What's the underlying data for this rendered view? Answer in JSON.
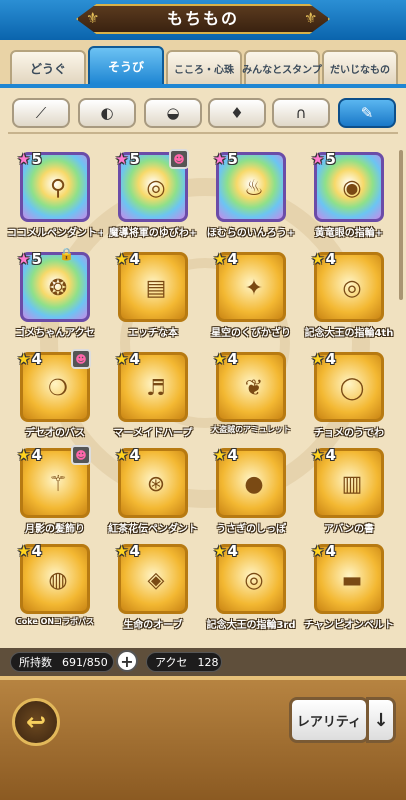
{
  "header": {
    "title": "もちもの"
  },
  "tabs": [
    {
      "label": "どうぐ"
    },
    {
      "label": "そうび"
    },
    {
      "label": "こころ・心珠"
    },
    {
      "label": "みんなとスタンプ"
    },
    {
      "label": "だいじなもの"
    }
  ],
  "categories": [
    {
      "icon": "sword-icon",
      "glyph": "⟋"
    },
    {
      "icon": "shield-icon",
      "glyph": "◐"
    },
    {
      "icon": "helmet-icon",
      "glyph": "◒"
    },
    {
      "icon": "shirt-icon",
      "glyph": "♦"
    },
    {
      "icon": "pants-icon",
      "glyph": "∩"
    },
    {
      "icon": "accessory-icon",
      "glyph": "✎"
    }
  ],
  "items": [
    {
      "name": "ココメルペンダント+",
      "rank": "5",
      "rainbow": true,
      "icon": "pendant-icon",
      "glyph": "⚲"
    },
    {
      "name": "魔導将軍のゆびわ+",
      "rank": "5",
      "rainbow": true,
      "icon": "ring-icon",
      "glyph": "◎",
      "badge": true
    },
    {
      "name": "ほむらのいんろう+",
      "rank": "5",
      "rainbow": true,
      "icon": "inro-icon",
      "glyph": "♨"
    },
    {
      "name": "黄竜眼の指輪+",
      "rank": "5",
      "rainbow": true,
      "icon": "ring-icon",
      "glyph": "◉"
    },
    {
      "name": "ゴメちゃんアクセ",
      "rank": "5",
      "rainbow": true,
      "icon": "winged-slime-icon",
      "glyph": "❂",
      "lock": true
    },
    {
      "name": "エッチな本",
      "rank": "4",
      "icon": "book-icon",
      "glyph": "▤"
    },
    {
      "name": "星空のくびかざり",
      "rank": "4",
      "icon": "necklace-icon",
      "glyph": "✦"
    },
    {
      "name": "記念大王の指輪4th",
      "rank": "4",
      "icon": "ring-icon",
      "glyph": "◎"
    },
    {
      "name": "デセオのバス",
      "rank": "4",
      "icon": "amulet-icon",
      "glyph": "❍",
      "badge": true
    },
    {
      "name": "マーメイドハープ",
      "rank": "4",
      "icon": "harp-icon",
      "glyph": "♬"
    },
    {
      "name": "大盗賊のアミュレット",
      "rank": "4",
      "icon": "amulet-icon",
      "glyph": "❦",
      "tiny": true
    },
    {
      "name": "チョメのうでわ",
      "rank": "4",
      "icon": "bracelet-icon",
      "glyph": "◯"
    },
    {
      "name": "月影の髪飾り",
      "rank": "4",
      "icon": "hairpin-icon",
      "glyph": "⚚",
      "badge": true
    },
    {
      "name": "紅茶花伝ペンダント",
      "rank": "4",
      "icon": "pendant-icon",
      "glyph": "⊛"
    },
    {
      "name": "うさぎのしっぽ",
      "rank": "4",
      "icon": "tail-icon",
      "glyph": "●"
    },
    {
      "name": "アバンの書",
      "rank": "4",
      "icon": "book-icon",
      "glyph": "▥"
    },
    {
      "name": "Coke ONコラボパス",
      "rank": "4",
      "icon": "pass-icon",
      "glyph": "◍",
      "tiny": true
    },
    {
      "name": "生命のオーブ",
      "rank": "4",
      "icon": "orb-icon",
      "glyph": "◈"
    },
    {
      "name": "記念大王の指輪3rd",
      "rank": "4",
      "icon": "ring-icon",
      "glyph": "◎"
    },
    {
      "name": "チャンピオンベルト",
      "rank": "4",
      "icon": "belt-icon",
      "glyph": "▬"
    }
  ],
  "status": {
    "owned_label": "所持数",
    "owned_value": "691/850",
    "plus": "+",
    "type_label": "アクセ",
    "type_value": "128"
  },
  "footer": {
    "back_glyph": "↩",
    "sort_label": "レアリティ",
    "sort_arrow": "↓"
  }
}
